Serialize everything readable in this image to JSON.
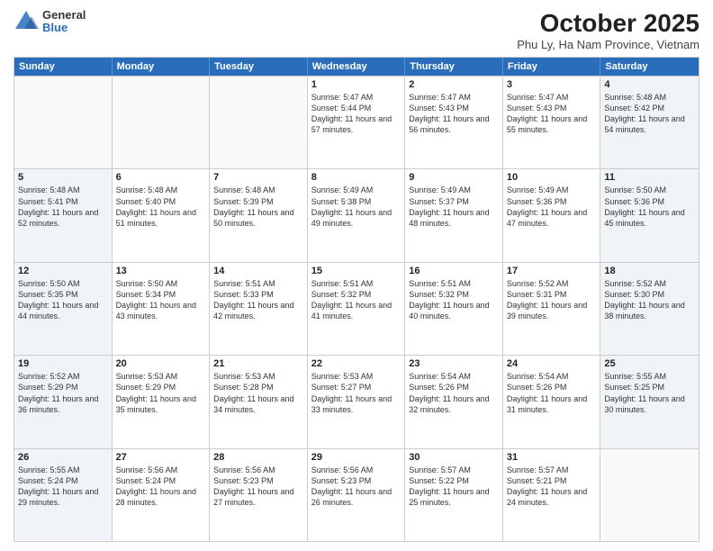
{
  "logo": {
    "general": "General",
    "blue": "Blue"
  },
  "title": "October 2025",
  "location": "Phu Ly, Ha Nam Province, Vietnam",
  "days": [
    "Sunday",
    "Monday",
    "Tuesday",
    "Wednesday",
    "Thursday",
    "Friday",
    "Saturday"
  ],
  "weeks": [
    [
      {
        "day": "",
        "text": ""
      },
      {
        "day": "",
        "text": ""
      },
      {
        "day": "",
        "text": ""
      },
      {
        "day": "1",
        "text": "Sunrise: 5:47 AM\nSunset: 5:44 PM\nDaylight: 11 hours and 57 minutes."
      },
      {
        "day": "2",
        "text": "Sunrise: 5:47 AM\nSunset: 5:43 PM\nDaylight: 11 hours and 56 minutes."
      },
      {
        "day": "3",
        "text": "Sunrise: 5:47 AM\nSunset: 5:43 PM\nDaylight: 11 hours and 55 minutes."
      },
      {
        "day": "4",
        "text": "Sunrise: 5:48 AM\nSunset: 5:42 PM\nDaylight: 11 hours and 54 minutes."
      }
    ],
    [
      {
        "day": "5",
        "text": "Sunrise: 5:48 AM\nSunset: 5:41 PM\nDaylight: 11 hours and 52 minutes."
      },
      {
        "day": "6",
        "text": "Sunrise: 5:48 AM\nSunset: 5:40 PM\nDaylight: 11 hours and 51 minutes."
      },
      {
        "day": "7",
        "text": "Sunrise: 5:48 AM\nSunset: 5:39 PM\nDaylight: 11 hours and 50 minutes."
      },
      {
        "day": "8",
        "text": "Sunrise: 5:49 AM\nSunset: 5:38 PM\nDaylight: 11 hours and 49 minutes."
      },
      {
        "day": "9",
        "text": "Sunrise: 5:49 AM\nSunset: 5:37 PM\nDaylight: 11 hours and 48 minutes."
      },
      {
        "day": "10",
        "text": "Sunrise: 5:49 AM\nSunset: 5:36 PM\nDaylight: 11 hours and 47 minutes."
      },
      {
        "day": "11",
        "text": "Sunrise: 5:50 AM\nSunset: 5:36 PM\nDaylight: 11 hours and 45 minutes."
      }
    ],
    [
      {
        "day": "12",
        "text": "Sunrise: 5:50 AM\nSunset: 5:35 PM\nDaylight: 11 hours and 44 minutes."
      },
      {
        "day": "13",
        "text": "Sunrise: 5:50 AM\nSunset: 5:34 PM\nDaylight: 11 hours and 43 minutes."
      },
      {
        "day": "14",
        "text": "Sunrise: 5:51 AM\nSunset: 5:33 PM\nDaylight: 11 hours and 42 minutes."
      },
      {
        "day": "15",
        "text": "Sunrise: 5:51 AM\nSunset: 5:32 PM\nDaylight: 11 hours and 41 minutes."
      },
      {
        "day": "16",
        "text": "Sunrise: 5:51 AM\nSunset: 5:32 PM\nDaylight: 11 hours and 40 minutes."
      },
      {
        "day": "17",
        "text": "Sunrise: 5:52 AM\nSunset: 5:31 PM\nDaylight: 11 hours and 39 minutes."
      },
      {
        "day": "18",
        "text": "Sunrise: 5:52 AM\nSunset: 5:30 PM\nDaylight: 11 hours and 38 minutes."
      }
    ],
    [
      {
        "day": "19",
        "text": "Sunrise: 5:52 AM\nSunset: 5:29 PM\nDaylight: 11 hours and 36 minutes."
      },
      {
        "day": "20",
        "text": "Sunrise: 5:53 AM\nSunset: 5:29 PM\nDaylight: 11 hours and 35 minutes."
      },
      {
        "day": "21",
        "text": "Sunrise: 5:53 AM\nSunset: 5:28 PM\nDaylight: 11 hours and 34 minutes."
      },
      {
        "day": "22",
        "text": "Sunrise: 5:53 AM\nSunset: 5:27 PM\nDaylight: 11 hours and 33 minutes."
      },
      {
        "day": "23",
        "text": "Sunrise: 5:54 AM\nSunset: 5:26 PM\nDaylight: 11 hours and 32 minutes."
      },
      {
        "day": "24",
        "text": "Sunrise: 5:54 AM\nSunset: 5:26 PM\nDaylight: 11 hours and 31 minutes."
      },
      {
        "day": "25",
        "text": "Sunrise: 5:55 AM\nSunset: 5:25 PM\nDaylight: 11 hours and 30 minutes."
      }
    ],
    [
      {
        "day": "26",
        "text": "Sunrise: 5:55 AM\nSunset: 5:24 PM\nDaylight: 11 hours and 29 minutes."
      },
      {
        "day": "27",
        "text": "Sunrise: 5:56 AM\nSunset: 5:24 PM\nDaylight: 11 hours and 28 minutes."
      },
      {
        "day": "28",
        "text": "Sunrise: 5:56 AM\nSunset: 5:23 PM\nDaylight: 11 hours and 27 minutes."
      },
      {
        "day": "29",
        "text": "Sunrise: 5:56 AM\nSunset: 5:23 PM\nDaylight: 11 hours and 26 minutes."
      },
      {
        "day": "30",
        "text": "Sunrise: 5:57 AM\nSunset: 5:22 PM\nDaylight: 11 hours and 25 minutes."
      },
      {
        "day": "31",
        "text": "Sunrise: 5:57 AM\nSunset: 5:21 PM\nDaylight: 11 hours and 24 minutes."
      },
      {
        "day": "",
        "text": ""
      }
    ]
  ]
}
